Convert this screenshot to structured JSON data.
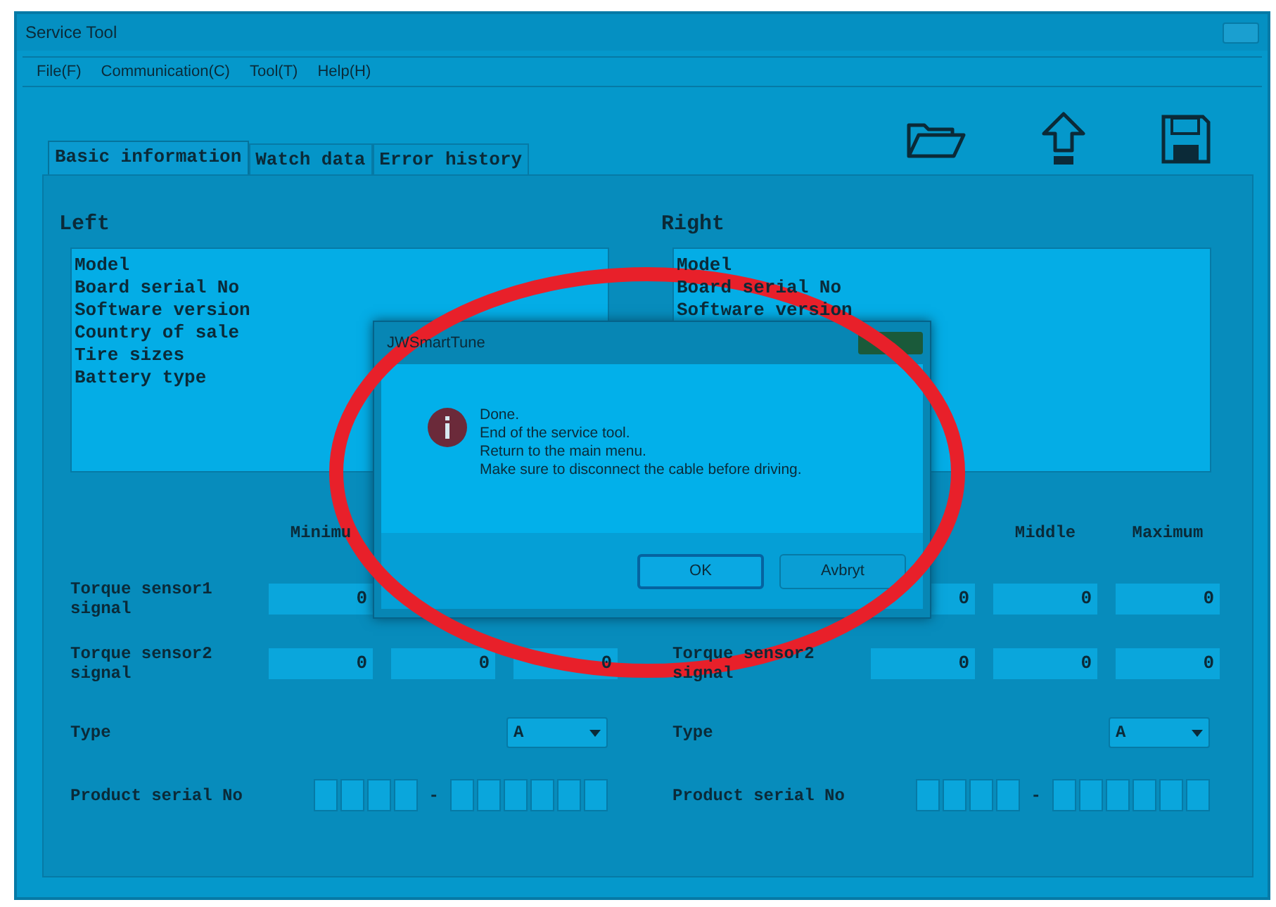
{
  "window": {
    "title": "Service Tool"
  },
  "menu": [
    "File(F)",
    "Communication(C)",
    "Tool(T)",
    "Help(H)"
  ],
  "tabs": [
    {
      "label": "Basic information",
      "selected": true
    },
    {
      "label": "Watch data",
      "selected": false
    },
    {
      "label": "Error history",
      "selected": false
    }
  ],
  "sides": [
    {
      "heading": "Left",
      "info_list": [
        "Model",
        "Board serial No",
        "Software version",
        "Country of sale",
        "Tire sizes",
        "Battery type"
      ],
      "column_headers": {
        "minimum": "Minimu"
      },
      "rows": [
        {
          "label": "Torque sensor1 signal",
          "values": {
            "minimum": "0"
          }
        },
        {
          "label": "Torque sensor2 signal",
          "values": {
            "minimum": "0",
            "middle": "0",
            "maximum": "0"
          }
        }
      ],
      "type_label": "Type",
      "type_value": "A",
      "serial_label": "Product serial No",
      "serial_separator": "-"
    },
    {
      "heading": "Right",
      "info_list": [
        "Model",
        "Board serial No",
        "Software version"
      ],
      "column_headers": {
        "middle": "Middle",
        "maximum": "Maximum"
      },
      "rows": [
        {
          "values": {
            "minimum": "0",
            "middle": "0",
            "maximum": "0"
          }
        },
        {
          "label": "Torque sensor2 signal",
          "values": {
            "minimum": "0",
            "middle": "0",
            "maximum": "0"
          }
        }
      ],
      "type_label": "Type",
      "type_value": "A",
      "serial_label": "Product serial No",
      "serial_separator": "-"
    }
  ],
  "dialog": {
    "title": "JWSmartTune",
    "message_lines": [
      "Done.",
      "End of the service tool.",
      "Return to the main menu.",
      "Make sure to disconnect the cable before driving."
    ],
    "buttons": [
      {
        "label": "OK",
        "selected": true
      },
      {
        "label": "Avbryt",
        "selected": false
      }
    ]
  }
}
